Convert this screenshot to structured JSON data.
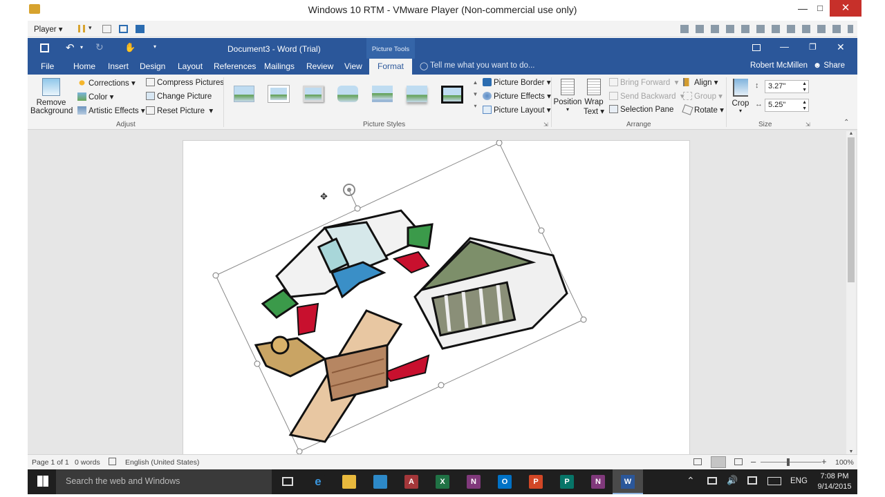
{
  "vmware": {
    "title": "Windows 10 RTM - VMware Player (Non-commercial use only)",
    "menu": "Player"
  },
  "word": {
    "doc_title": "Document3 - Word (Trial)",
    "context_title": "Picture Tools",
    "tabs": [
      "File",
      "Home",
      "Insert",
      "Design",
      "Layout",
      "References",
      "Mailings",
      "Review",
      "View",
      "Format"
    ],
    "active_tab": "Format",
    "tell_me": "Tell me what you want to do...",
    "user": "Robert McMillen",
    "share": "Share"
  },
  "ribbon": {
    "remove_background": [
      "Remove",
      "Background"
    ],
    "corrections": "Corrections",
    "color": "Color",
    "artistic_effects": "Artistic Effects",
    "compress": "Compress Pictures",
    "change_picture": "Change Picture",
    "reset_picture": "Reset Picture",
    "adjust": "Adjust",
    "picture_styles": "Picture Styles",
    "picture_border": "Picture Border",
    "picture_effects": "Picture Effects",
    "picture_layout": "Picture Layout",
    "position": "Position",
    "wrap_text": [
      "Wrap",
      "Text"
    ],
    "bring_forward": "Bring Forward",
    "send_backward": "Send Backward",
    "selection_pane": "Selection Pane",
    "align": "Align",
    "group": "Group",
    "rotate": "Rotate",
    "arrange": "Arrange",
    "crop": "Crop",
    "height": "3.27\"",
    "width": "5.25\"",
    "size": "Size"
  },
  "status": {
    "page": "Page 1 of 1",
    "words": "0 words",
    "language": "English (United States)",
    "zoom": "100%"
  },
  "taskbar": {
    "search": "Search the web and Windows",
    "lang": "ENG",
    "time": "7:08 PM",
    "date": "9/14/2015"
  },
  "colors": {
    "word_blue": "#2b579a",
    "taskbar": "#1f1f1f"
  }
}
